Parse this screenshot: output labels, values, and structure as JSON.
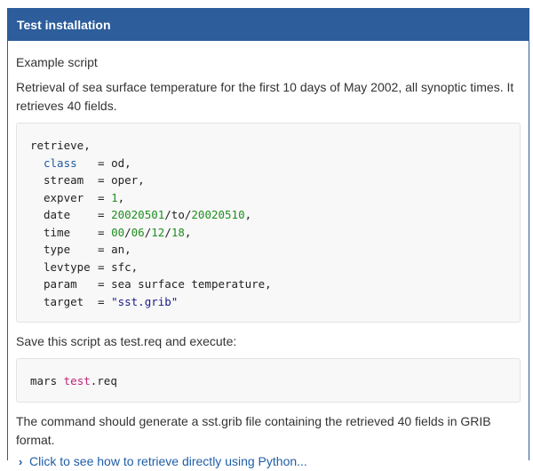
{
  "header": {
    "title": "Test installation"
  },
  "section": {
    "subtitle": "Example script",
    "description": "Retrieval of sea surface temperature for the first 10 days of May 2002, all synoptic times. It retrieves 40 fields."
  },
  "script": {
    "verb": "retrieve,",
    "lines": [
      {
        "key": "class",
        "value": "od,",
        "style": "kw"
      },
      {
        "key": "stream",
        "value": "oper,"
      },
      {
        "key": "expver",
        "value": "1",
        "suffix": ","
      },
      {
        "key": "date",
        "date_parts": [
          "20020501",
          "/to/",
          "20020510",
          ","
        ]
      },
      {
        "key": "time",
        "time_parts": [
          "00",
          "/",
          "06",
          "/",
          "12",
          "/",
          "18",
          ","
        ]
      },
      {
        "key": "type",
        "value": "an,"
      },
      {
        "key": "levtype",
        "value": "sfc,"
      },
      {
        "key": "param",
        "value": "sea surface temperature,"
      },
      {
        "key": "target",
        "value": "\"sst.grib\""
      }
    ]
  },
  "save_text": "Save this script as test.req and execute:",
  "command": {
    "prefix": "mars ",
    "file": "test",
    "ext": ".req"
  },
  "result_text": "The command should generate a sst.grib file containing the retrieved 40 fields in GRIB format.",
  "python_link": {
    "icon": "chevron-right-icon",
    "label": "Click to see how to retrieve directly using Python..."
  },
  "colors": {
    "header_bg": "#2d5d9b",
    "link": "#1f5ea8",
    "number": "#1f8f1f",
    "keyword": "#21599a"
  }
}
